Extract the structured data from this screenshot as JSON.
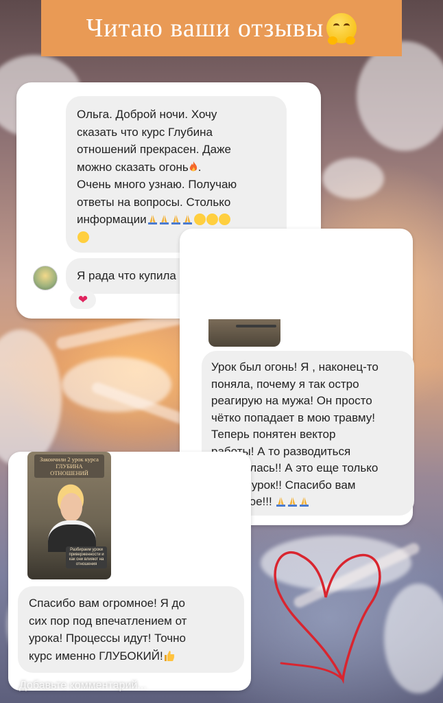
{
  "story": {
    "title": "Читаю ваши отзывы",
    "title_emoji": "hugging-face-icon",
    "accent_color": "#e99a55",
    "comment_placeholder": "Добавьте комментарий..."
  },
  "review1": {
    "message_lines": [
      "Ольга. Доброй ночи. Хочу",
      "сказать что курс Глубина",
      "отношений прекрасен. Даже",
      "можно сказать огонь",
      "Очень много узнаю. Получаю",
      "ответы на вопросы. Столько",
      "информации"
    ],
    "reply": "Я рада что купила этот курс.",
    "reaction": "heart"
  },
  "review2": {
    "message_lines": [
      "Урок был огонь! Я , наконец-то",
      "поняла, почему я так остро",
      "реагирую на мужа! Он просто",
      "чётко попадает в мою травму!",
      "Теперь понятен вектор",
      "работы! А то разводиться",
      "собиралась!! А это еще только",
      "второй урок!! Спасибо вам",
      "огромное!!!"
    ],
    "reaction": "heart"
  },
  "review3": {
    "thumb_title_lines": [
      "Закончили 2 урок курса",
      "ГЛУБИНА",
      "ОТНОШЕНИЙ"
    ],
    "thumb_caption": "Разбираем уроки приверженности и как они влияют на отношения",
    "message_lines": [
      "Спасибо вам огромное! Я до",
      "сих пор под впечатлением от",
      "урока! Процессы идут! Точно",
      "курс именно ГЛУБОКИЙ!"
    ]
  },
  "decor": {
    "heart_color": "#d9252f"
  }
}
